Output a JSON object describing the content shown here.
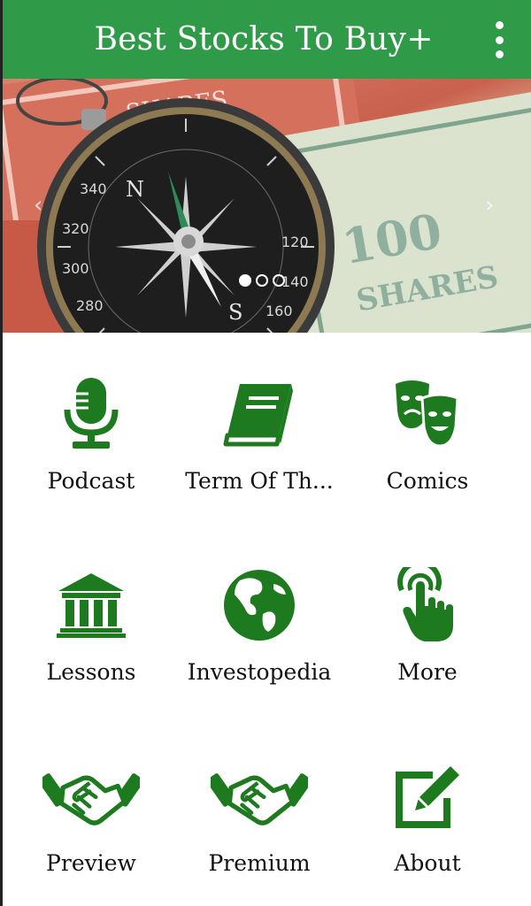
{
  "app": {
    "title": "Best Stocks To Buy+"
  },
  "banner": {
    "slide_count": 3,
    "active_slide": 1
  },
  "colors": {
    "accent": "#2f9a47",
    "icon_green": "#1d7a1f"
  },
  "menu": {
    "items": [
      {
        "label": "Podcast",
        "icon": "microphone-icon"
      },
      {
        "label": "Term Of Th...",
        "icon": "book-icon"
      },
      {
        "label": "Comics",
        "icon": "theater-masks-icon"
      },
      {
        "label": "Lessons",
        "icon": "bank-icon"
      },
      {
        "label": "Investopedia",
        "icon": "globe-icon"
      },
      {
        "label": "More",
        "icon": "touch-hand-icon"
      },
      {
        "label": "Preview",
        "icon": "handshake-icon"
      },
      {
        "label": "Premium",
        "icon": "handshake-icon"
      },
      {
        "label": "About",
        "icon": "edit-icon"
      }
    ]
  }
}
